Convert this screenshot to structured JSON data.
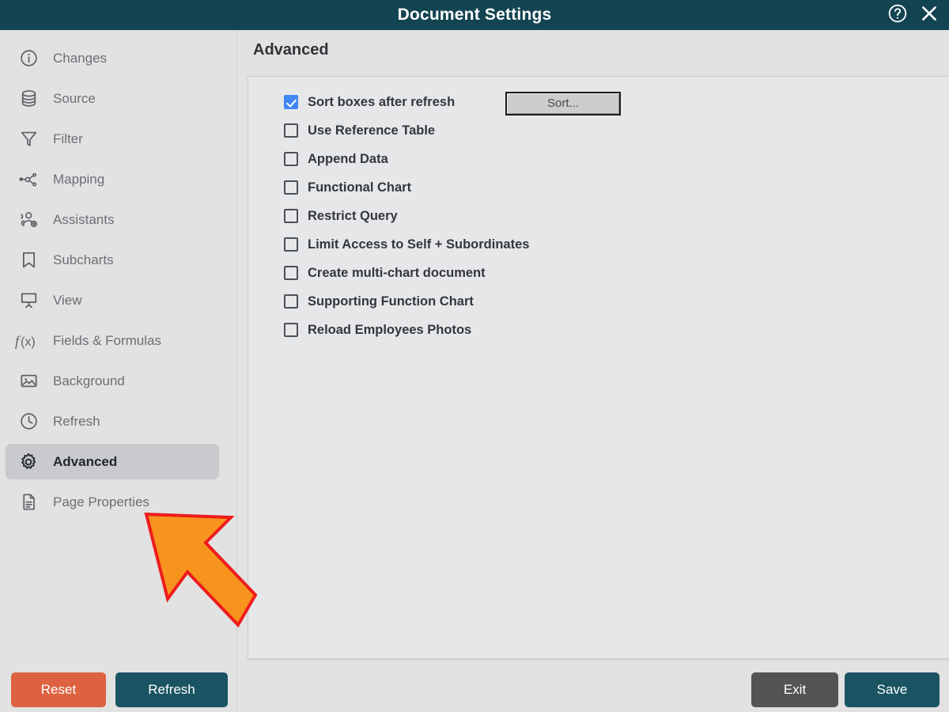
{
  "window": {
    "title": "Document Settings",
    "help_icon": "help-circle-icon",
    "close_icon": "close-icon"
  },
  "sidebar": {
    "items": [
      {
        "label": "Changes",
        "icon": "info-circle-icon",
        "selected": false
      },
      {
        "label": "Source",
        "icon": "database-icon",
        "selected": false
      },
      {
        "label": "Filter",
        "icon": "funnel-icon",
        "selected": false
      },
      {
        "label": "Mapping",
        "icon": "nodes-icon",
        "selected": false
      },
      {
        "label": "Assistants",
        "icon": "users-add-icon",
        "selected": false
      },
      {
        "label": "Subcharts",
        "icon": "bookmark-icon",
        "selected": false
      },
      {
        "label": "View",
        "icon": "presentation-icon",
        "selected": false
      },
      {
        "label": "Fields & Formulas",
        "icon": "function-icon",
        "selected": false
      },
      {
        "label": "Background",
        "icon": "image-icon",
        "selected": false
      },
      {
        "label": "Refresh",
        "icon": "clock-icon",
        "selected": false
      },
      {
        "label": "Advanced",
        "icon": "gear-icon",
        "selected": true
      },
      {
        "label": "Page Properties",
        "icon": "document-icon",
        "selected": false
      }
    ]
  },
  "main": {
    "page_title": "Advanced",
    "sort_button_label": "Sort...",
    "checkboxes": [
      {
        "label": "Sort boxes after refresh",
        "checked": true
      },
      {
        "label": "Use Reference Table",
        "checked": false
      },
      {
        "label": "Append Data",
        "checked": false
      },
      {
        "label": "Functional Chart",
        "checked": false
      },
      {
        "label": "Restrict Query",
        "checked": false
      },
      {
        "label": "Limit Access to Self + Subordinates",
        "checked": false
      },
      {
        "label": "Create multi-chart document",
        "checked": false
      },
      {
        "label": "Supporting Function Chart",
        "checked": false
      },
      {
        "label": "Reload Employees Photos",
        "checked": false
      }
    ]
  },
  "footer": {
    "reset_label": "Reset",
    "refresh_label": "Refresh",
    "exit_label": "Exit",
    "save_label": "Save"
  },
  "colors": {
    "titlebar": "#134451",
    "accent_teal": "#1a5463",
    "accent_orange": "#dd6242",
    "checkbox_blue": "#4287f5",
    "selected_item": "#c8cacd",
    "cursor_fill": "#f7941e",
    "cursor_stroke": "#ee1c1c"
  }
}
